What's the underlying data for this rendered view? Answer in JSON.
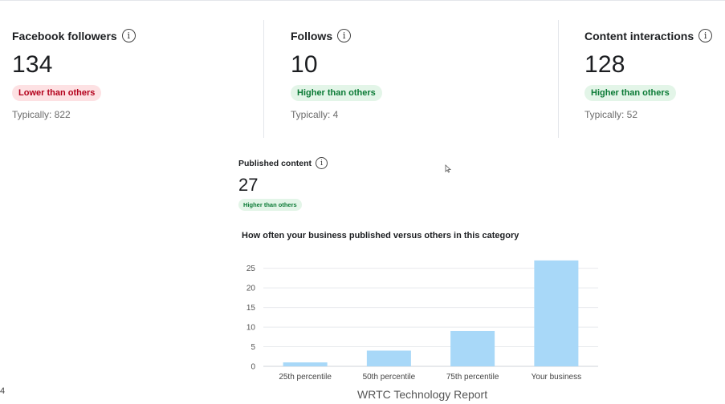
{
  "metrics": [
    {
      "label": "Facebook followers",
      "value": "134",
      "badge": "Lower than others",
      "badge_status": "lower",
      "typical": "Typically: 822"
    },
    {
      "label": "Follows",
      "value": "10",
      "badge": "Higher than others",
      "badge_status": "higher",
      "typical": "Typically: 4"
    },
    {
      "label": "Content interactions",
      "value": "128",
      "badge": "Higher than others",
      "badge_status": "higher",
      "typical": "Typically: 52"
    }
  ],
  "published": {
    "label": "Published content",
    "value": "27",
    "badge": "Higher than others"
  },
  "chart_title": "How often your business published versus others in this category",
  "chart_data": {
    "type": "bar",
    "categories": [
      "25th percentile",
      "50th percentile",
      "75th percentile",
      "Your business"
    ],
    "values": [
      1,
      4,
      9,
      27
    ],
    "yticks": [
      0,
      5,
      10,
      15,
      20,
      25
    ],
    "ylim": [
      0,
      28
    ],
    "grid": true,
    "bar_color": "#a8d8f8"
  },
  "info_glyph": "i",
  "footer_text": "WRTC Technology Report",
  "stray_text": "4",
  "colors": {
    "lower_bg": "#fde1e3",
    "lower_fg": "#b3001b",
    "higher_bg": "#e3f5e8",
    "higher_fg": "#0a7a35"
  }
}
